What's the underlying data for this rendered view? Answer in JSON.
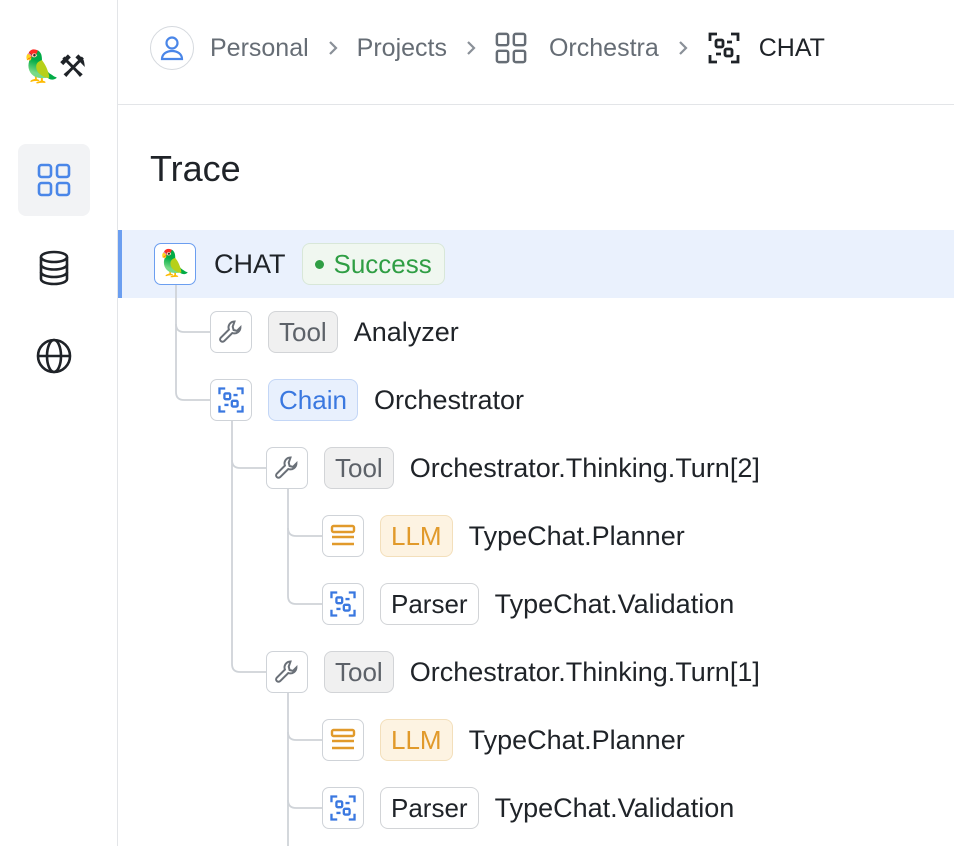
{
  "sidebar": {
    "logo": "🦜⚒",
    "items": [
      {
        "name": "dashboard",
        "icon": "grid-icon",
        "active": true
      },
      {
        "name": "datasets",
        "icon": "database-icon",
        "active": false
      },
      {
        "name": "web",
        "icon": "globe-icon",
        "active": false
      }
    ]
  },
  "breadcrumb": {
    "items": [
      {
        "label": "Personal",
        "icon": "user-icon"
      },
      {
        "label": "Projects",
        "icon": ""
      },
      {
        "label": "Orchestra",
        "icon": "grid-icon"
      },
      {
        "label": "CHAT",
        "icon": "chain-icon"
      }
    ]
  },
  "page": {
    "title": "Trace"
  },
  "trace": {
    "root": {
      "name": "CHAT",
      "status": "Success",
      "icon": "parrot-icon"
    },
    "nodes": [
      {
        "type": "Tool",
        "name": "Analyzer"
      },
      {
        "type": "Chain",
        "name": "Orchestrator"
      },
      {
        "type": "Tool",
        "name": "Orchestrator.Thinking.Turn[2]"
      },
      {
        "type": "LLM",
        "name": "TypeChat.Planner"
      },
      {
        "type": "Parser",
        "name": "TypeChat.Validation"
      },
      {
        "type": "Tool",
        "name": "Orchestrator.Thinking.Turn[1]"
      },
      {
        "type": "LLM",
        "name": "TypeChat.Planner"
      },
      {
        "type": "Parser",
        "name": "TypeChat.Validation"
      }
    ]
  },
  "colors": {
    "accent": "#3a78e0",
    "success": "#2f9e44",
    "llm": "#e19a2b",
    "selected_row": "#eaf1fd"
  }
}
